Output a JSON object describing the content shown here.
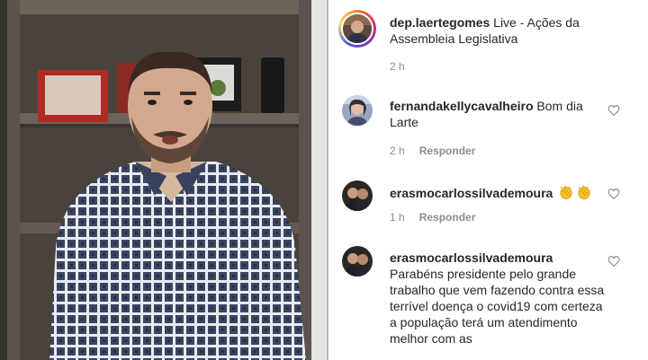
{
  "post": {
    "username": "dep.laertegomes",
    "caption": "Live - Ações da Assembleia Legislativa",
    "time": "2 h"
  },
  "comments": [
    {
      "username": "fernandakellycavalheiro",
      "text": "Bom dia Larte",
      "time": "2 h",
      "reply_label": "Responder"
    },
    {
      "username": "erasmocarlossilvademoura",
      "text": "",
      "emojis": [
        "clapping-hands-icon",
        "clapping-hands-icon"
      ],
      "time": "1 h",
      "reply_label": "Responder"
    },
    {
      "username": "erasmocarlossilvademoura",
      "text": "Parabéns presidente pelo grande trabalho que vem fazendo contra essa terrível doença o covid19 com certeza a população terá um atendimento melhor com as"
    }
  ],
  "colors": {
    "username": "#262626",
    "secondary": "#8e8e8e",
    "video_background": "#2e2a26"
  }
}
